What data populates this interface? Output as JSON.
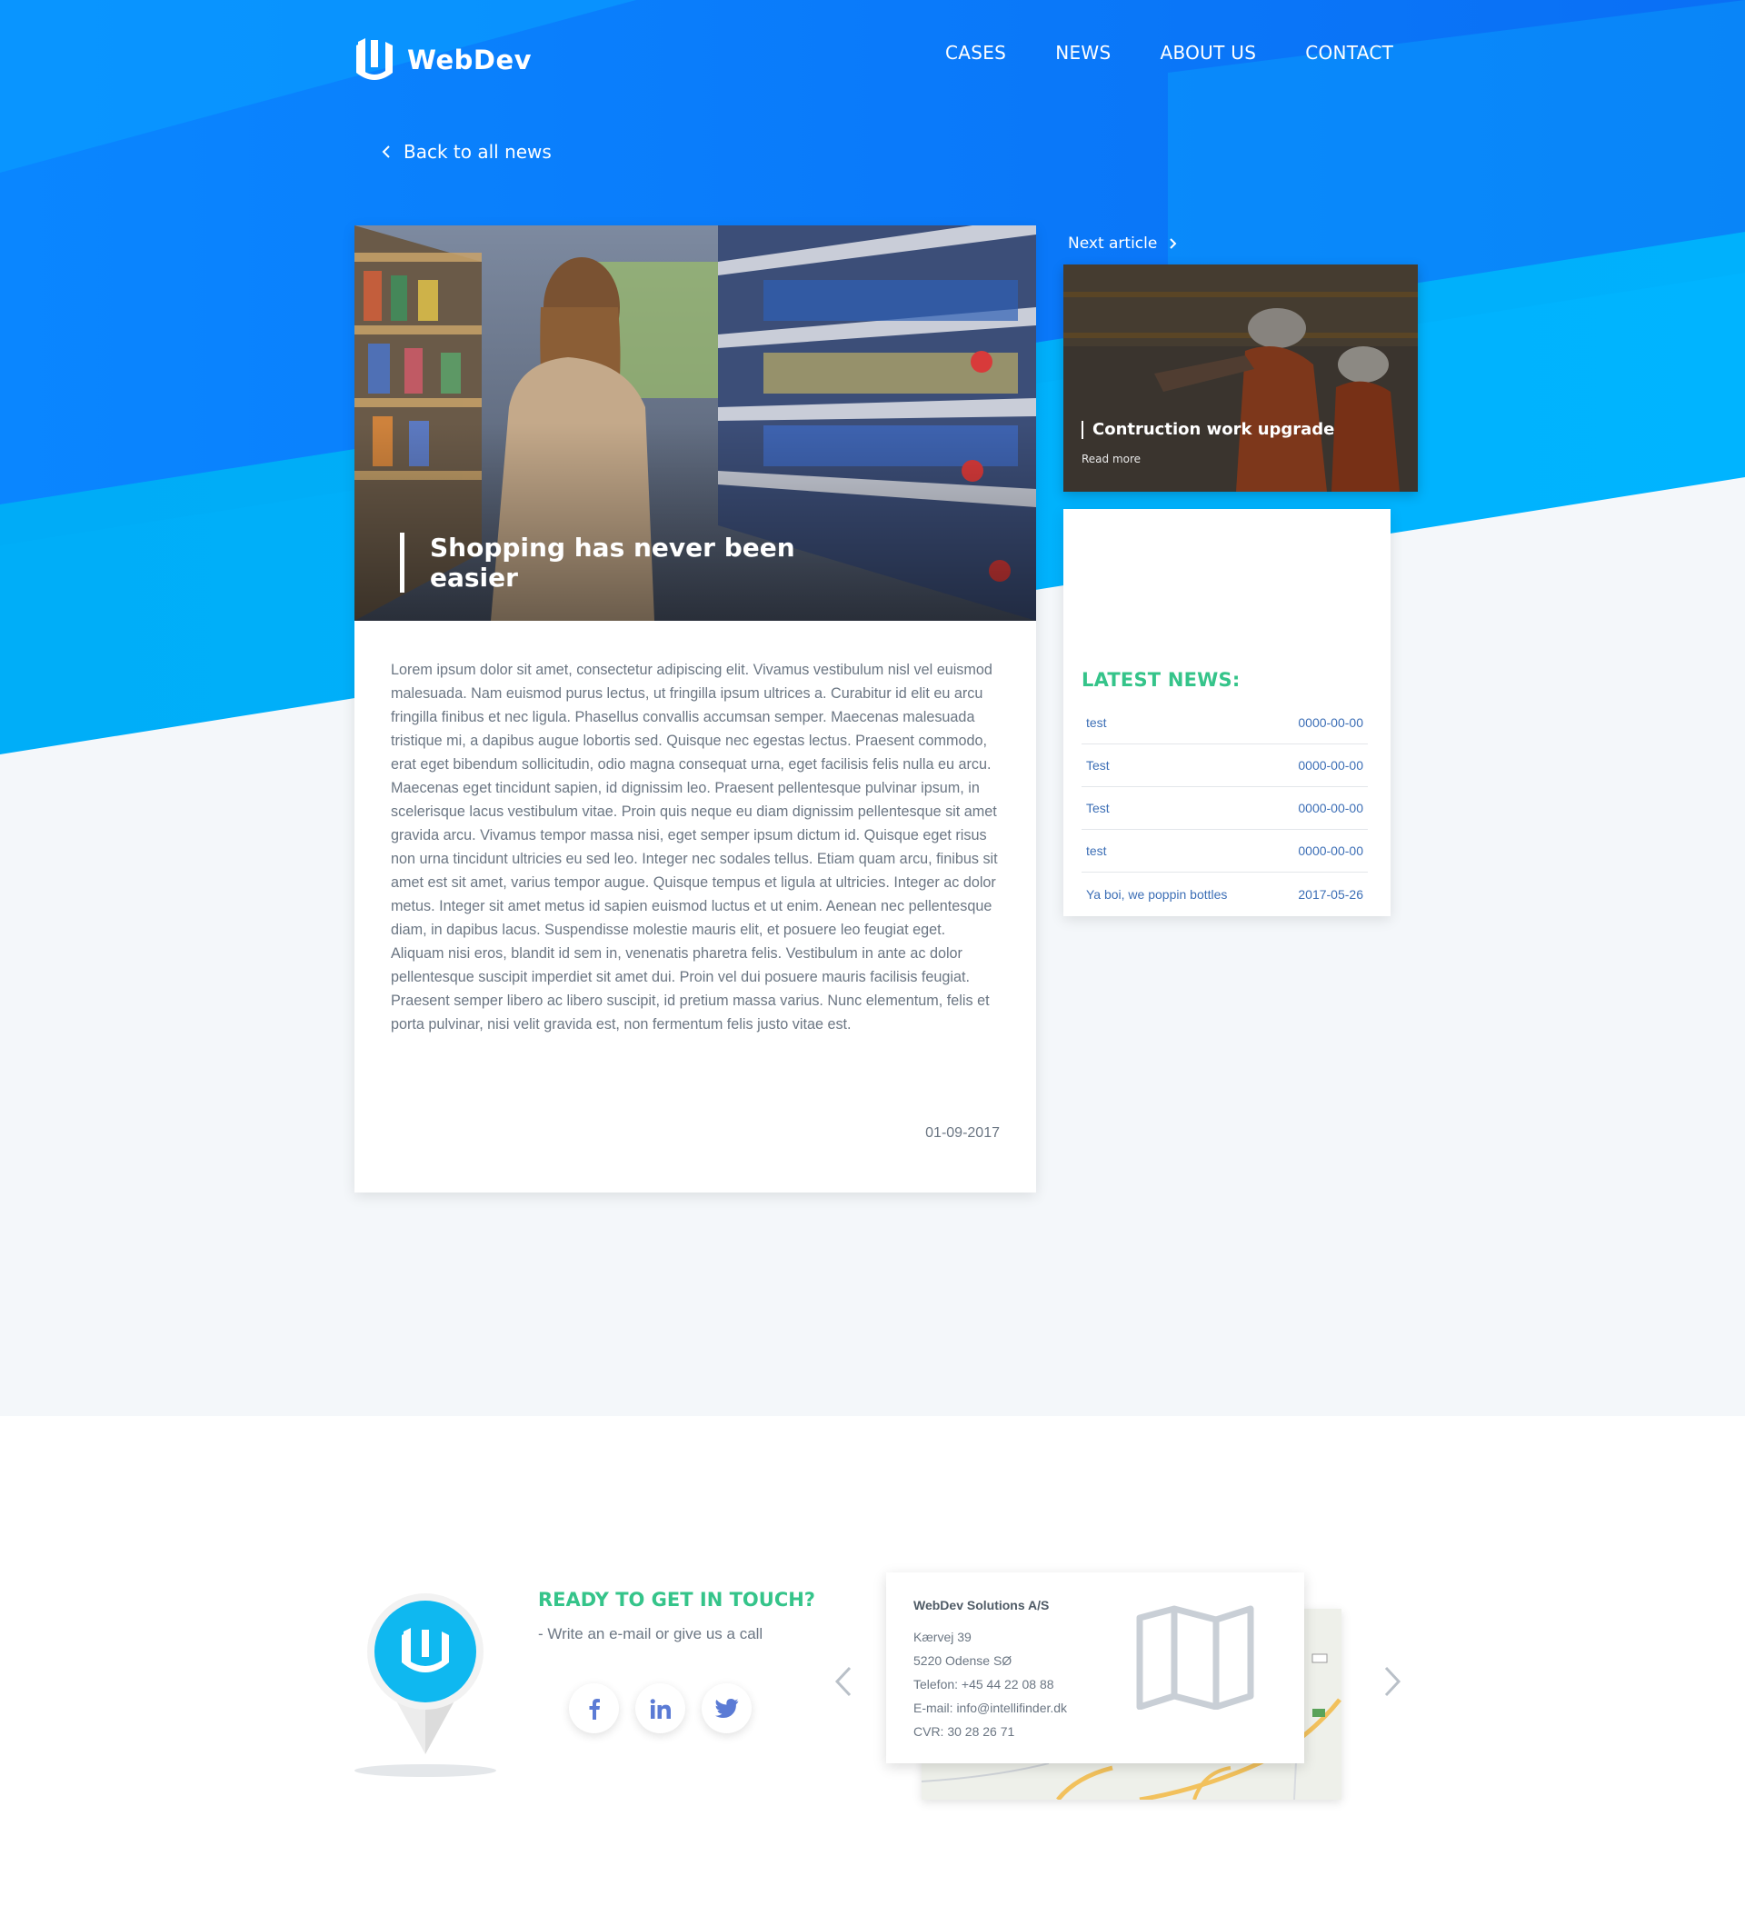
{
  "brand": {
    "name": "WebDev"
  },
  "nav": {
    "items": [
      {
        "label": "CASES"
      },
      {
        "label": "NEWS"
      },
      {
        "label": "ABOUT US"
      },
      {
        "label": "CONTACT"
      }
    ]
  },
  "back_link": {
    "label": "Back to all news"
  },
  "article": {
    "title": "Shopping has never been easier",
    "body": "Lorem ipsum dolor sit amet, consectetur adipiscing elit. Vivamus vestibulum nisl vel euismod malesuada. Nam euismod purus lectus, ut fringilla ipsum ultrices a. Curabitur id elit eu arcu fringilla finibus et nec ligula. Phasellus convallis accumsan semper. Maecenas malesuada tristique mi, a dapibus augue lobortis sed. Quisque nec egestas lectus. Praesent commodo, erat eget bibendum sollicitudin, odio magna consequat urna, eget facilisis felis nulla eu arcu. Maecenas eget tincidunt sapien, id dignissim leo. Praesent pellentesque pulvinar ipsum, in scelerisque lacus vestibulum vitae. Proin quis neque eu diam dignissim pellentesque sit amet gravida arcu. Vivamus tempor massa nisi, eget semper ipsum dictum id. Quisque eget risus non urna tincidunt ultricies eu sed leo. Integer nec sodales tellus. Etiam quam arcu, finibus sit amet est sit amet, varius tempor augue. Quisque tempus et ligula at ultricies. Integer ac dolor metus. Integer sit amet metus id sapien euismod luctus et ut enim. Aenean nec pellentesque diam, in dapibus lacus. Suspendisse molestie mauris elit, et posuere leo feugiat eget. Aliquam nisi eros, blandit id sem in, venenatis pharetra felis. Vestibulum in ante ac dolor pellentesque suscipit imperdiet sit amet dui. Proin vel dui posuere mauris facilisis feugiat. Praesent semper libero ac libero suscipit, id pretium massa varius. Nunc elementum, felis et porta pulvinar, nisi velit gravida est, non fermentum felis justo vitae est.",
    "date": "01-09-2017"
  },
  "next_article": {
    "label": "Next article",
    "title": "Contruction work upgrade",
    "read_more": "Read more"
  },
  "latest_news": {
    "title": "LATEST NEWS:",
    "items": [
      {
        "title": "test",
        "date": "0000-00-00"
      },
      {
        "title": "Test",
        "date": "0000-00-00"
      },
      {
        "title": "Test",
        "date": "0000-00-00"
      },
      {
        "title": "test",
        "date": "0000-00-00"
      },
      {
        "title": "Ya boi, we poppin bottles",
        "date": "2017-05-26"
      }
    ]
  },
  "contact": {
    "title": "READY TO GET IN TOUCH?",
    "subtitle": "- Write an e-mail or give us a call",
    "company": "WebDev Solutions A/S",
    "lines": [
      "Kærvej 39",
      "5220 Odense SØ",
      "Telefon: +45 44 22 08 88",
      "E-mail: info@intellifinder.dk",
      "CVR: 30 28 26 71"
    ],
    "socials": [
      "facebook-icon",
      "linkedin-icon",
      "twitter-icon"
    ]
  },
  "colors": {
    "hero_blue": "#0a7cff",
    "hero_light_blue": "#00b0ff",
    "accent_green": "#35c48a",
    "link_blue": "#3d6fb6",
    "page_bg": "#f4f7fa"
  }
}
